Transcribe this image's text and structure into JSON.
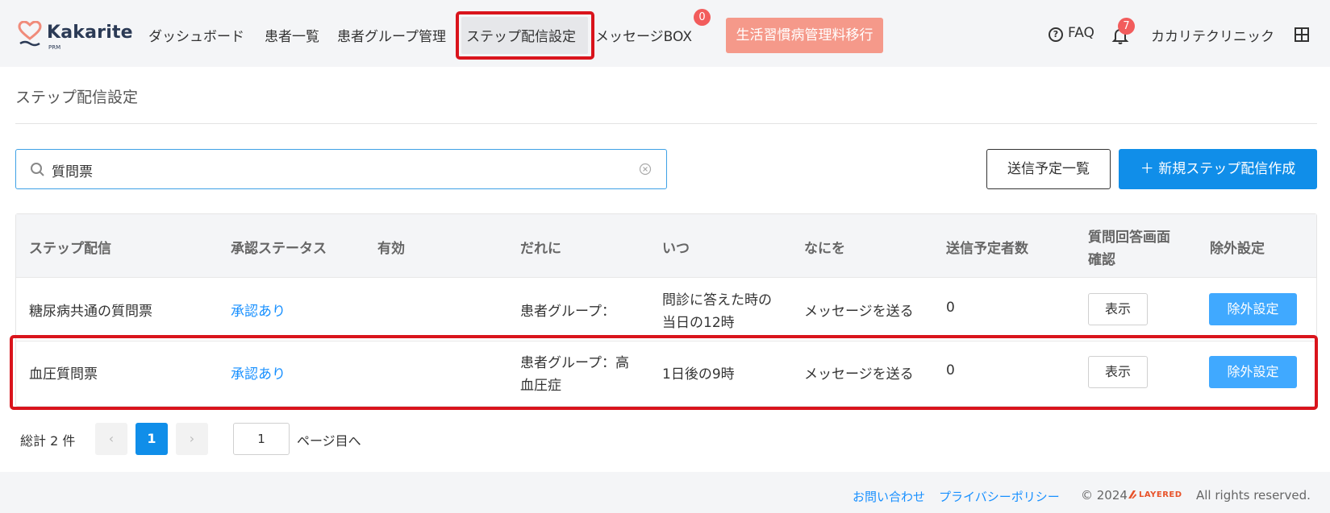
{
  "header": {
    "logo": {
      "name": "Kakarite",
      "sub": "PRM"
    },
    "nav": [
      {
        "label": "ダッシュボード"
      },
      {
        "label": "患者一覧"
      },
      {
        "label": "患者グループ管理"
      },
      {
        "label": "ステップ配信設定"
      },
      {
        "label": "メッセージBOX"
      }
    ],
    "message_badge": "0",
    "cta_label": "生活習慣病管理料移行",
    "faq_label": "FAQ",
    "bell_badge": "7",
    "clinic_name": "カカリテクリニック",
    "icons": {
      "faq": "help-circle-icon",
      "bell": "bell-icon",
      "grid": "grid-icon"
    }
  },
  "page": {
    "title": "ステップ配信設定",
    "search": {
      "value": "質問票",
      "placeholder": ""
    },
    "schedule_button": "送信予定一覧",
    "new_button": "＋ 新規ステップ配信作成"
  },
  "table": {
    "headers": [
      "ステップ配信",
      "承認ステータス",
      "有効",
      "だれに",
      "いつ",
      "なにを",
      "送信予定者数",
      "質問回答画面",
      "確認",
      "除外設定"
    ],
    "rows": [
      {
        "name": "糖尿病共通の質問票",
        "status": "承認あり",
        "who": "患者グループ：",
        "who2": "",
        "when": "問診に答えた時の",
        "when2": "当日の12時",
        "what": "メッセージを送る",
        "count": "0",
        "show": "表示",
        "exclude": "除外設定"
      },
      {
        "name": "血圧質問票",
        "status": "承認あり",
        "who": "患者グループ：高",
        "who2": "血圧症",
        "when": "1日後の9時",
        "when2": "",
        "what": "メッセージを送る",
        "count": "0",
        "show": "表示",
        "exclude": "除外設定"
      }
    ]
  },
  "pagination": {
    "total": "総計 2 件",
    "prev": "‹",
    "current": "1",
    "next": "›",
    "jump_value": "1",
    "jump_label": "ページ目へ"
  },
  "footer": {
    "contact": "お問い合わせ",
    "privacy": "プライバシーポリシー",
    "copyright": "© 2024",
    "brand": "LAYERED",
    "rights": "All rights reserved."
  },
  "colors": {
    "primary": "#108ee9",
    "link": "#1890ff",
    "cta": "#f5998a",
    "badge": "#f25c5c",
    "highlight": "#d9141c"
  }
}
